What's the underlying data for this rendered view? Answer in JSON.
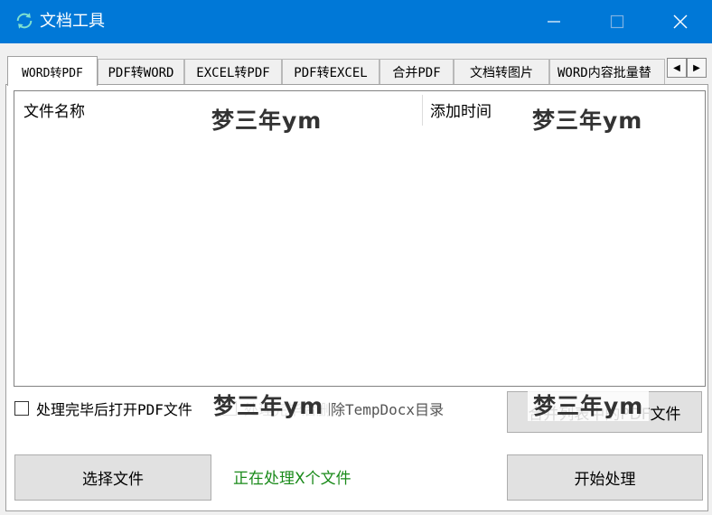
{
  "window": {
    "title": "文档工具",
    "colors": {
      "titlebar": "#0078d7",
      "status_text": "#1a8a1a"
    },
    "icons": {
      "app": "refresh-icon",
      "minimize": "minimize-icon",
      "maximize": "maximize-icon",
      "close": "close-icon"
    }
  },
  "tabs": [
    {
      "label": "WORD转PDF"
    },
    {
      "label": "PDF转WORD"
    },
    {
      "label": "EXCEL转PDF"
    },
    {
      "label": "PDF转EXCEL"
    },
    {
      "label": "合并PDF"
    },
    {
      "label": "文档转图片"
    },
    {
      "label": "WORD内容批量替"
    }
  ],
  "tab_scroll": {
    "left": "◀",
    "right": "▶"
  },
  "file_list": {
    "columns": [
      {
        "label": "文件名称"
      },
      {
        "label": "添加时间"
      }
    ],
    "rows": []
  },
  "watermark": "梦三年ym",
  "options": {
    "open_after": "处理完毕后打开PDF文件",
    "delete_temp": "处理完毕后删除TempDocx目录"
  },
  "buttons": {
    "merge": "合并列表中的PDF文件",
    "select_file": "选择文件",
    "start": "开始处理"
  },
  "status_text": "正在处理X个文件"
}
